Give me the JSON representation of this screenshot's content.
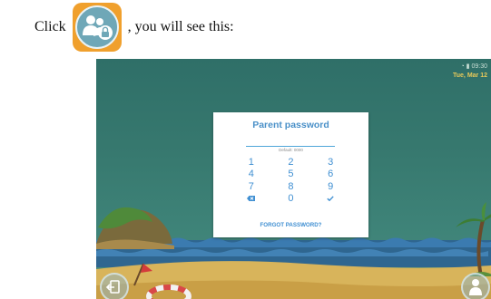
{
  "instruction": {
    "click_word": "Click",
    "continuation": ", you will see this:",
    "icon": "parents-lock-icon"
  },
  "status_bar": {
    "icons": [
      "wifi-icon",
      "battery-icon"
    ],
    "time": "09:30",
    "date": "Tue, Mar 12"
  },
  "dialog": {
    "title": "Parent password",
    "password_value": "",
    "hint": "Default: 0000",
    "keys": [
      "1",
      "2",
      "3",
      "4",
      "5",
      "6",
      "7",
      "8",
      "9",
      "backspace-icon",
      "0",
      "checkmark-icon"
    ],
    "forgot_label": "FORGOT PASSWORD?"
  },
  "corner_buttons": {
    "left": "exit-icon",
    "right": "parent-icon"
  }
}
